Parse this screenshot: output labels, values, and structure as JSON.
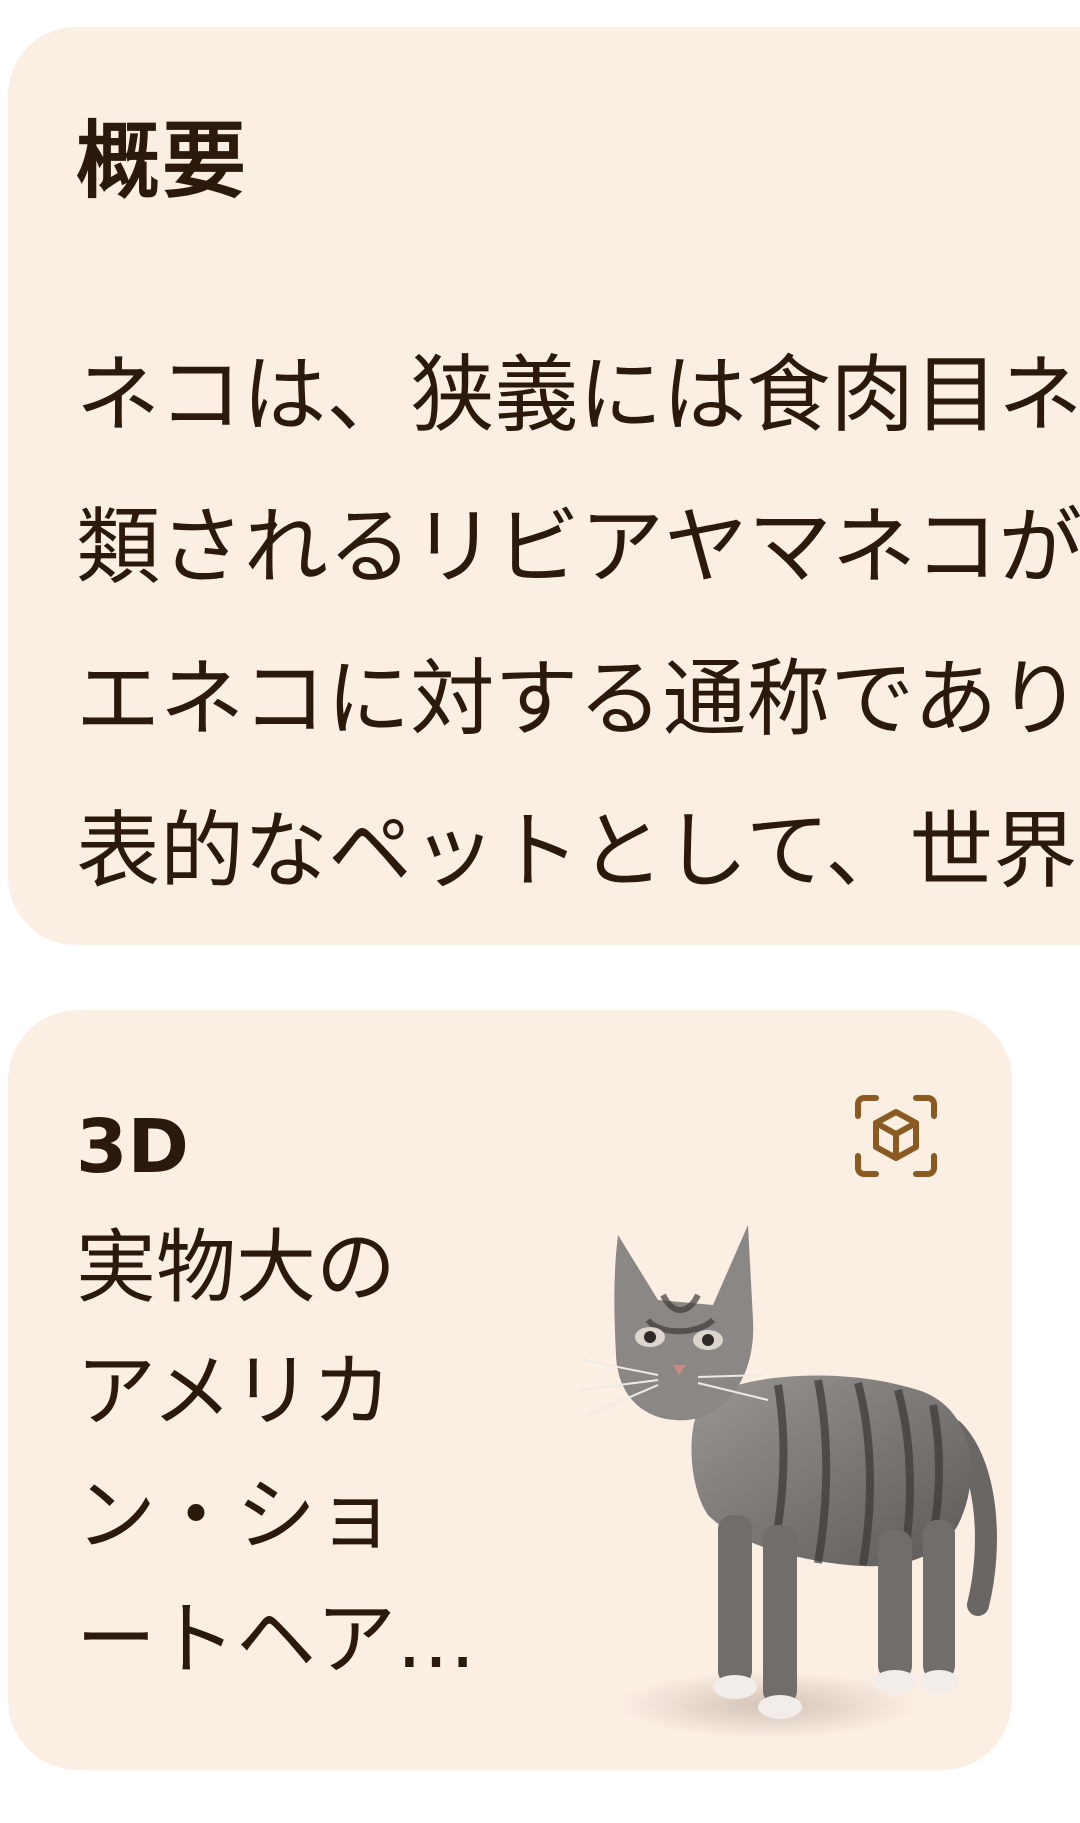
{
  "overview": {
    "title": "概要",
    "lines": [
      "ネコは、狭義には食肉目ネコ科に分",
      "類されるリビアヤマネコが家畜化したイ",
      "エネコに対する通称であり、犬と並ぶ代",
      "表的なペットとして、世界中で"
    ]
  },
  "model": {
    "label": "3D",
    "title_lines": [
      "実物大の",
      "アメリカ",
      "ン・ショ",
      "ートヘア…"
    ],
    "icon": "view-in-ar-icon",
    "image": "tabby-cat-3d-model"
  },
  "colors": {
    "card_background": "#fbeee3",
    "text": "#2b1a0c",
    "icon_accent": "#8a5a22"
  }
}
